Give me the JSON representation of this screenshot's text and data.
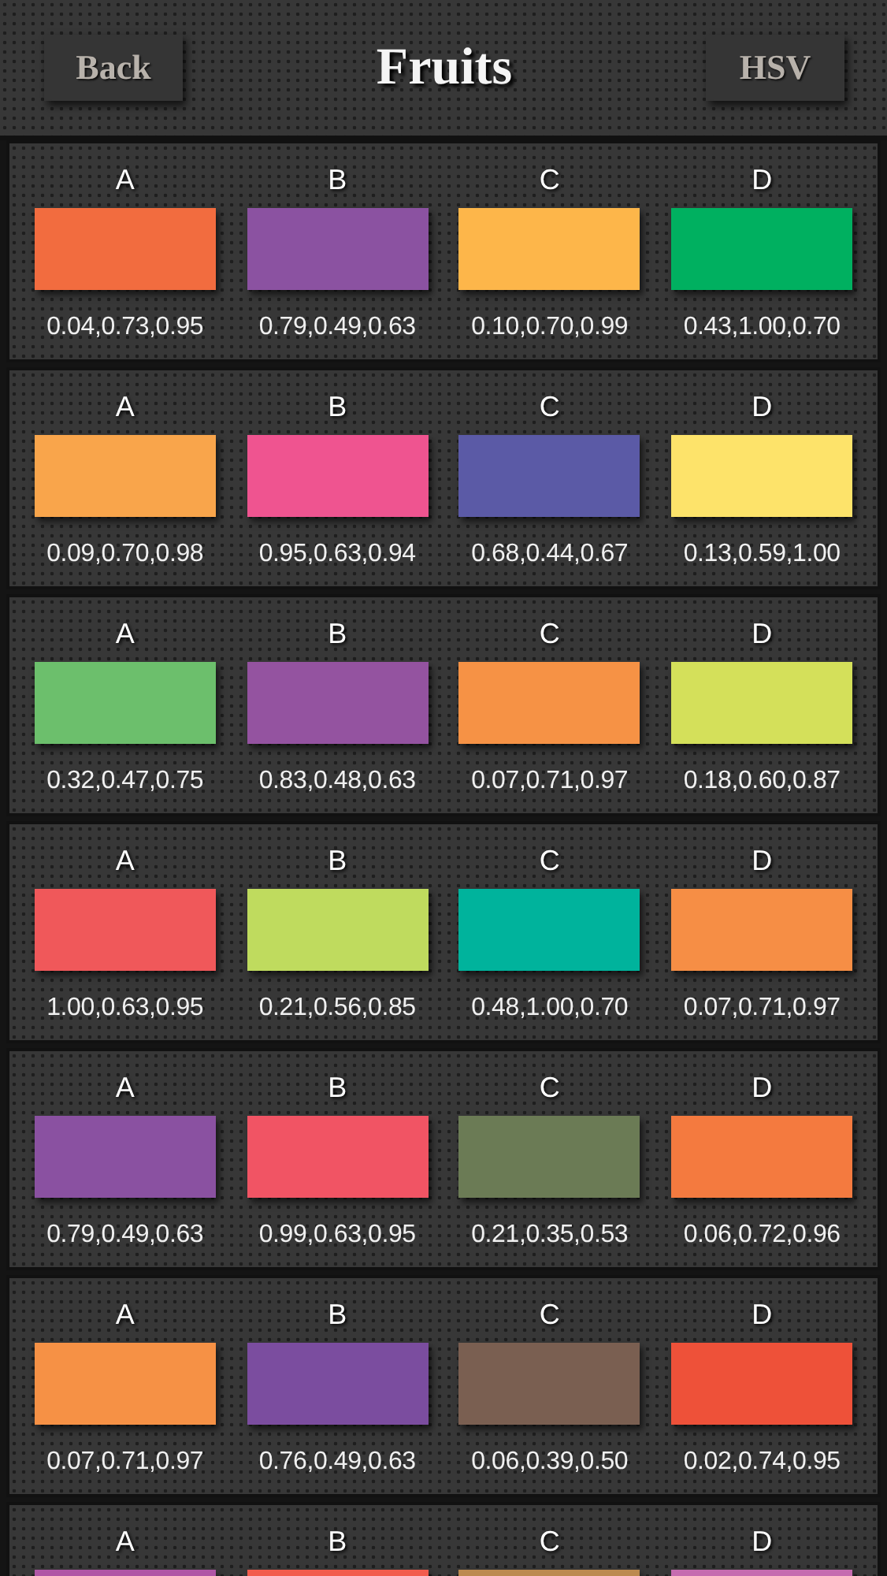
{
  "header": {
    "back_button": "Back",
    "title": "Fruits",
    "mode_button": "HSV"
  },
  "cards": [
    {
      "swatches": [
        {
          "label": "A",
          "color": "#f26c3f",
          "value": "0.04,0.73,0.95"
        },
        {
          "label": "B",
          "color": "#8b52a1",
          "value": "0.79,0.49,0.63"
        },
        {
          "label": "C",
          "color": "#fdb64a",
          "value": "0.10,0.70,0.99"
        },
        {
          "label": "D",
          "color": "#00b060",
          "value": "0.43,1.00,0.70"
        }
      ]
    },
    {
      "swatches": [
        {
          "label": "A",
          "color": "#f9a54b",
          "value": "0.09,0.70,0.98"
        },
        {
          "label": "B",
          "color": "#ef5490",
          "value": "0.95,0.63,0.94"
        },
        {
          "label": "C",
          "color": "#5b5aa6",
          "value": "0.68,0.44,0.67"
        },
        {
          "label": "D",
          "color": "#fde36a",
          "value": "0.13,0.59,1.00"
        }
      ]
    },
    {
      "swatches": [
        {
          "label": "A",
          "color": "#6cbf6c",
          "value": "0.32,0.47,0.75"
        },
        {
          "label": "B",
          "color": "#9453a0",
          "value": "0.83,0.48,0.63"
        },
        {
          "label": "C",
          "color": "#f69245",
          "value": "0.07,0.71,0.97"
        },
        {
          "label": "D",
          "color": "#d4e05a",
          "value": "0.18,0.60,0.87"
        }
      ]
    },
    {
      "swatches": [
        {
          "label": "A",
          "color": "#f0585a",
          "value": "1.00,0.63,0.95"
        },
        {
          "label": "B",
          "color": "#bfdb5e",
          "value": "0.21,0.56,0.85"
        },
        {
          "label": "C",
          "color": "#00b39c",
          "value": "0.48,1.00,0.70"
        },
        {
          "label": "D",
          "color": "#f68e45",
          "value": "0.07,0.71,0.97"
        }
      ]
    },
    {
      "swatches": [
        {
          "label": "A",
          "color": "#8a51a1",
          "value": "0.79,0.49,0.63"
        },
        {
          "label": "B",
          "color": "#f15464",
          "value": "0.99,0.63,0.95"
        },
        {
          "label": "C",
          "color": "#6b7b55",
          "value": "0.21,0.35,0.53"
        },
        {
          "label": "D",
          "color": "#f47a3f",
          "value": "0.06,0.72,0.96"
        }
      ]
    },
    {
      "swatches": [
        {
          "label": "A",
          "color": "#f69145",
          "value": "0.07,0.71,0.97"
        },
        {
          "label": "B",
          "color": "#7b4d9f",
          "value": "0.76,0.49,0.63"
        },
        {
          "label": "C",
          "color": "#7a5f51",
          "value": "0.06,0.39,0.50"
        },
        {
          "label": "D",
          "color": "#ee5139",
          "value": "0.02,0.74,0.95"
        }
      ]
    },
    {
      "swatches": [
        {
          "label": "A",
          "color": "#b056a6"
        },
        {
          "label": "B",
          "color": "#f25c4d"
        },
        {
          "label": "C",
          "color": "#bc8a50"
        },
        {
          "label": "D",
          "color": "#c66cb0"
        }
      ]
    }
  ]
}
